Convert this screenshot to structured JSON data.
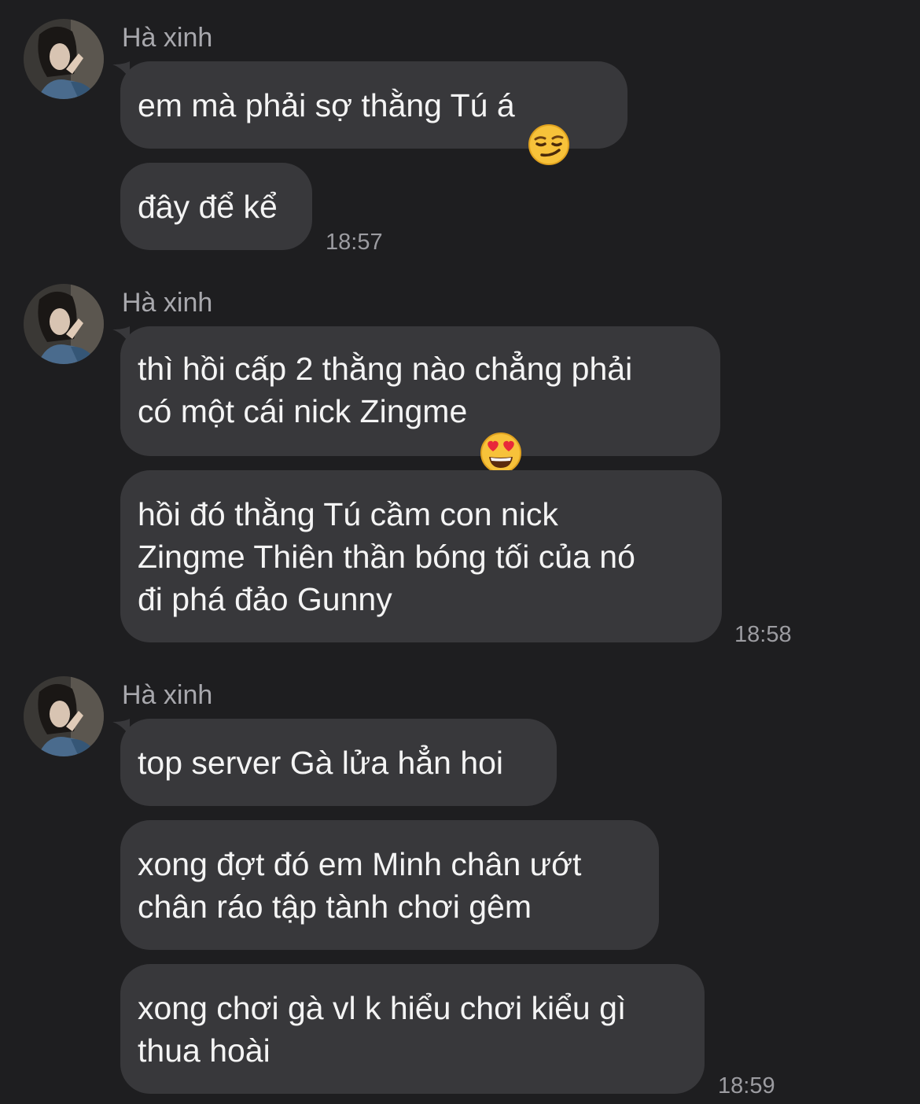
{
  "groups": [
    {
      "sender": "Hà xinh",
      "messages": [
        {
          "text": "em mà phải sợ thằng Tú á",
          "emoji": "smirking-face"
        },
        {
          "text": "đây để kể"
        }
      ],
      "time": "18:57"
    },
    {
      "sender": "Hà xinh",
      "messages": [
        {
          "text": "thì hồi cấp 2 thằng nào chẳng phải\ncó một cái nick Zingme",
          "emoji": "heart-eyes-face"
        },
        {
          "text": "hồi đó thằng Tú cầm con nick\nZingme Thiên thần bóng tối của nó\nđi phá đảo Gunny"
        }
      ],
      "time": "18:58"
    },
    {
      "sender": "Hà xinh",
      "messages": [
        {
          "text": "top server Gà lửa hẳn hoi"
        },
        {
          "text": "xong đợt đó em Minh chân ướt\nchân ráo tập tành chơi gêm"
        },
        {
          "text": "xong chơi gà vl k hiểu chơi kiểu gì\nthua hoài"
        }
      ],
      "time": "18:59"
    }
  ],
  "colors": {
    "background": "#1e1e20",
    "bubble": "#38383b",
    "sender": "#a8a8ad",
    "timestamp": "#9c9ca1",
    "text": "#f4f4f4"
  }
}
